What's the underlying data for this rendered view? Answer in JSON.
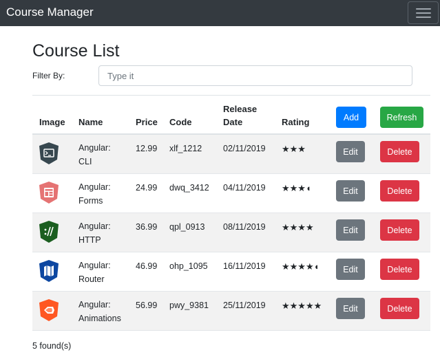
{
  "navbar": {
    "brand": "Course Manager",
    "menu_icon": "hamburger-icon"
  },
  "page": {
    "title": "Course List"
  },
  "filter": {
    "label": "Filter By:",
    "placeholder": "Type it",
    "value": ""
  },
  "table": {
    "headers": {
      "image": "Image",
      "name": "Name",
      "price": "Price",
      "code": "Code",
      "release_line1": "Release",
      "release_line2": "Date",
      "rating": "Rating"
    },
    "add_label": "Add",
    "refresh_label": "Refresh",
    "edit_label": "Edit",
    "delete_label": "Delete",
    "rows": [
      {
        "name_line1": "Angular:",
        "name_line2": "CLI",
        "price": "12.99",
        "code": "xlf_1212",
        "release": "02/11/2019",
        "rating": 3,
        "stars": "★★★",
        "icon": "cli-icon",
        "icon_color": "#37474f"
      },
      {
        "name_line1": "Angular:",
        "name_line2": "Forms",
        "price": "24.99",
        "code": "dwq_3412",
        "release": "04/11/2019",
        "rating": 3.5,
        "stars": "★★★◖",
        "icon": "forms-icon",
        "icon_color": "#e57373"
      },
      {
        "name_line1": "Angular:",
        "name_line2": "HTTP",
        "price": "36.99",
        "code": "qpl_0913",
        "release": "08/11/2019",
        "rating": 4,
        "stars": "★★★★",
        "icon": "http-icon",
        "icon_color": "#1b5e20"
      },
      {
        "name_line1": "Angular:",
        "name_line2": "Router",
        "price": "46.99",
        "code": "ohp_1095",
        "release": "16/11/2019",
        "rating": 4.5,
        "stars": "★★★★◖",
        "icon": "router-icon",
        "icon_color": "#0d47a1"
      },
      {
        "name_line1": "Angular:",
        "name_line2": "Animations",
        "price": "56.99",
        "code": "pwy_9381",
        "release": "25/11/2019",
        "rating": 5,
        "stars": "★★★★★",
        "icon": "animations-icon",
        "icon_color": "#ff5722"
      }
    ]
  },
  "footer": {
    "found_text": "5 found(s)"
  }
}
